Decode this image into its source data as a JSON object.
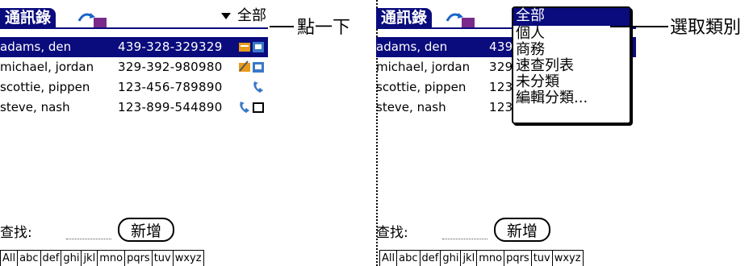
{
  "left": {
    "tab_title": "通訊錄",
    "category_label": "全部",
    "contacts": [
      {
        "name": "adams, den",
        "phone": "439-328-329329",
        "icons": [
          "card-icon",
          "contact-icon"
        ]
      },
      {
        "name": "michael, jordan",
        "phone": "329-392-980980",
        "icons": [
          "pen-card-icon",
          "contact-icon"
        ]
      },
      {
        "name": "scottie, pippen",
        "phone": "123-456-789890",
        "icons": [
          "phone-icon"
        ]
      },
      {
        "name": "steve, nash",
        "phone": "123-899-544890",
        "icons": [
          "phone-icon",
          "note-icon"
        ]
      }
    ],
    "find_label": "查找:",
    "new_button": "新增",
    "alpha_tabs": [
      "All",
      "abc",
      "def",
      "ghi",
      "jkl",
      "mno",
      "pqrs",
      "tuv",
      "wxyz"
    ],
    "callout": "點一下"
  },
  "right": {
    "tab_title": "通訊錄",
    "contacts": [
      {
        "name": "adams, den",
        "phone_partial": "439"
      },
      {
        "name": "michael, jordan",
        "phone_partial": "329"
      },
      {
        "name": "scottie, pippen",
        "phone_partial": "123"
      },
      {
        "name": "steve, nash",
        "phone_partial": "123"
      }
    ],
    "dropdown_items": [
      "全部",
      "個人",
      "商務",
      "速查列表",
      "未分類",
      "編輯分類..."
    ],
    "find_label": "查找:",
    "new_button": "新增",
    "alpha_tabs": [
      "All",
      "abc",
      "def",
      "ghi",
      "jkl",
      "mno",
      "pqrs",
      "tuv",
      "wxyz"
    ],
    "callout": "選取類別"
  },
  "colors": {
    "selection": "#0a0b7c",
    "icon_orange": "#e89a1a",
    "icon_blue": "#3a78c8"
  }
}
